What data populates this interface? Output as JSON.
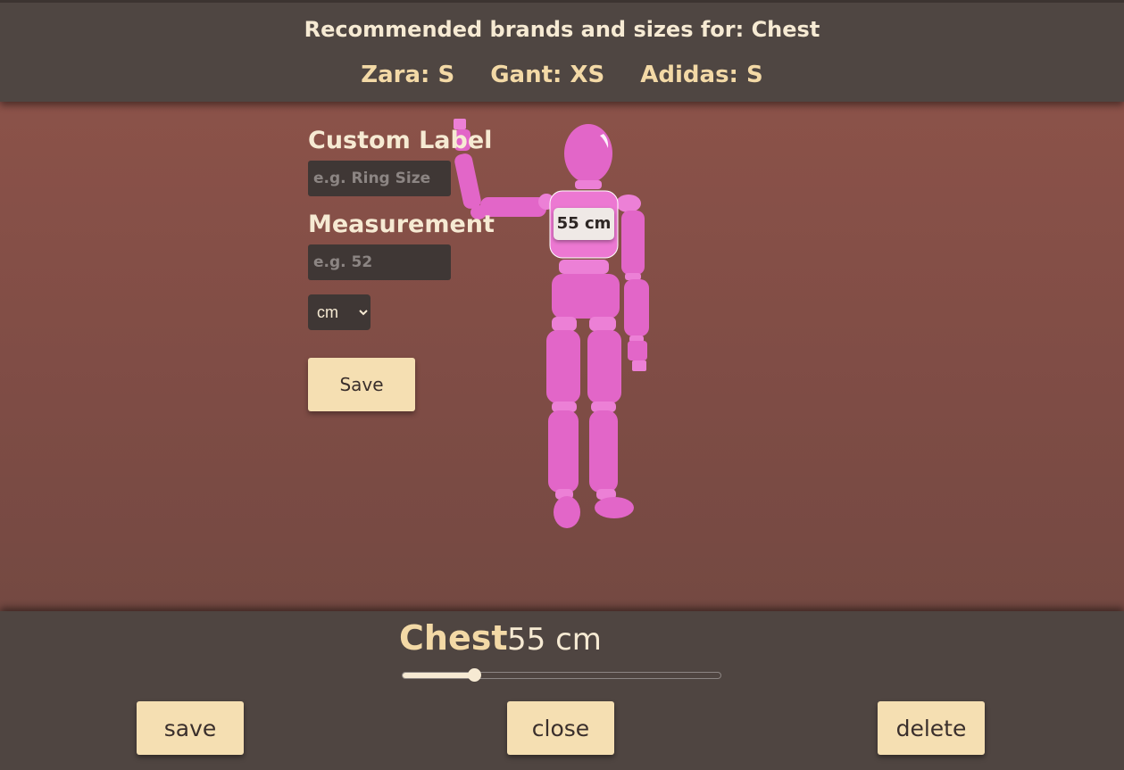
{
  "header": {
    "title": "Recommended brands and sizes for: Chest",
    "brands": [
      "Zara: S",
      "Gant: XS",
      "Adidas: S"
    ]
  },
  "form": {
    "custom_label_heading": "Custom Label",
    "custom_label_placeholder": "e.g. Ring Size",
    "measurement_heading": "Measurement",
    "measurement_placeholder": "e.g. 52",
    "unit_selected": "cm",
    "save_label": "Save"
  },
  "mannequin": {
    "tag_label": "55 cm",
    "body_color": "#e266c8",
    "highlight_color": "#ec80d6"
  },
  "bottom": {
    "measure_name": "Chest",
    "measure_value": "55 cm",
    "slider_fraction": 0.225,
    "buttons": {
      "save": "save",
      "close": "close",
      "delete": "delete"
    }
  },
  "colors": {
    "accent": "#f5dfb2",
    "panel": "#4f4541",
    "stage": "#8b5249"
  }
}
